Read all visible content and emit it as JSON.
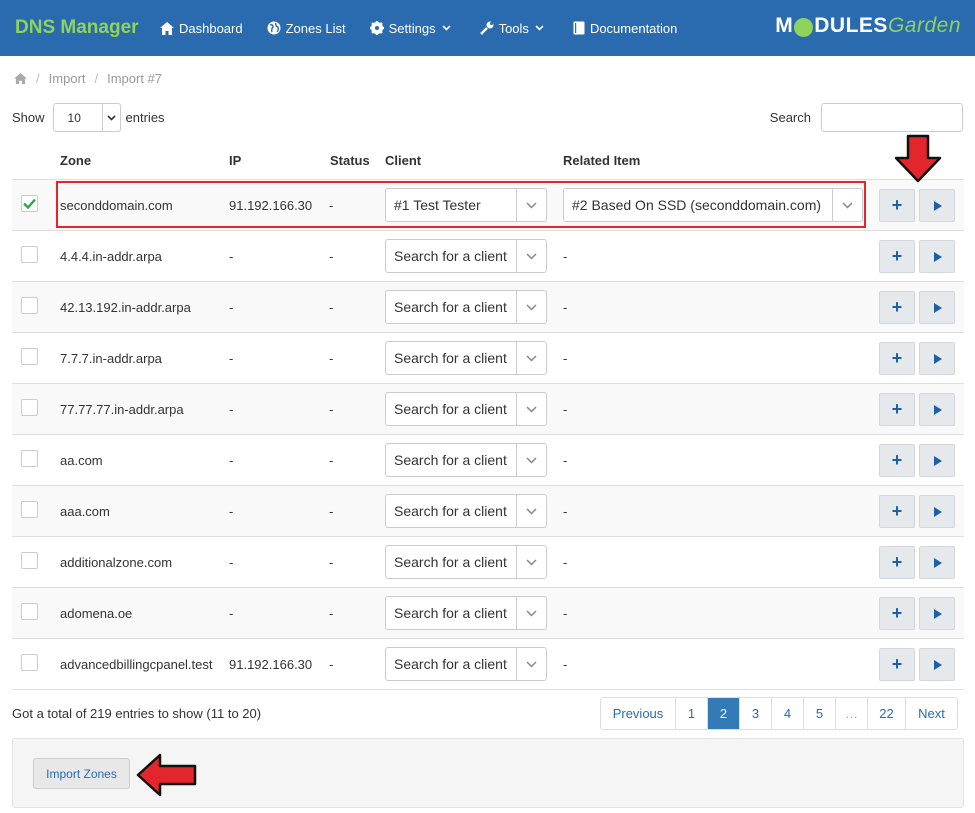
{
  "app": {
    "title": "DNS Manager",
    "nav": [
      {
        "label": "Dashboard",
        "icon": "home-icon"
      },
      {
        "label": "Zones List",
        "icon": "globe-icon"
      },
      {
        "label": "Settings",
        "icon": "gear-icon"
      },
      {
        "label": "Tools",
        "icon": "wrench-icon"
      },
      {
        "label": "Documentation",
        "icon": "book-icon"
      }
    ],
    "logo": {
      "part1": "M",
      "part2": "DULES",
      "part3": "Garden"
    }
  },
  "breadcrumb": [
    "Import",
    "Import #7"
  ],
  "controls": {
    "show_label": "Show",
    "entries_value": "10",
    "entries_label": "entries",
    "search_label": "Search",
    "search_value": ""
  },
  "table": {
    "columns": [
      "Zone",
      "IP",
      "Status",
      "Client",
      "Related Item"
    ],
    "rows": [
      {
        "checked": true,
        "zone": "seconddomain.com",
        "ip": "91.192.166.30",
        "status": "-",
        "client": "#1 Test Tester",
        "related": "#2 Based On SSD (seconddomain.com)"
      },
      {
        "checked": false,
        "zone": "4.4.4.in-addr.arpa",
        "ip": "-",
        "status": "-",
        "client": "Search for a client",
        "related": "-"
      },
      {
        "checked": false,
        "zone": "42.13.192.in-addr.arpa",
        "ip": "-",
        "status": "-",
        "client": "Search for a client",
        "related": "-"
      },
      {
        "checked": false,
        "zone": "7.7.7.in-addr.arpa",
        "ip": "-",
        "status": "-",
        "client": "Search for a client",
        "related": "-"
      },
      {
        "checked": false,
        "zone": "77.77.77.in-addr.arpa",
        "ip": "-",
        "status": "-",
        "client": "Search for a client",
        "related": "-"
      },
      {
        "checked": false,
        "zone": "aa.com",
        "ip": "-",
        "status": "-",
        "client": "Search for a client",
        "related": "-"
      },
      {
        "checked": false,
        "zone": "aaa.com",
        "ip": "-",
        "status": "-",
        "client": "Search for a client",
        "related": "-"
      },
      {
        "checked": false,
        "zone": "additionalzone.com",
        "ip": "-",
        "status": "-",
        "client": "Search for a client",
        "related": "-"
      },
      {
        "checked": false,
        "zone": "adomena.oe",
        "ip": "-",
        "status": "-",
        "client": "Search for a client",
        "related": "-"
      },
      {
        "checked": false,
        "zone": "advancedbillingcpanel.test",
        "ip": "91.192.166.30",
        "status": "-",
        "client": "Search for a client",
        "related": "-"
      }
    ]
  },
  "footer": {
    "info": "Got a total of 219 entries to show (11 to 20)",
    "pagination": [
      "Previous",
      "1",
      "2",
      "3",
      "4",
      "5",
      "…",
      "22",
      "Next"
    ],
    "active_page": "2",
    "import_button": "Import Zones"
  },
  "colors": {
    "navbar": "#2a6bb0",
    "brand_green": "#8fd35a",
    "highlight_red": "#e3262b",
    "active_page": "#337ab7"
  }
}
